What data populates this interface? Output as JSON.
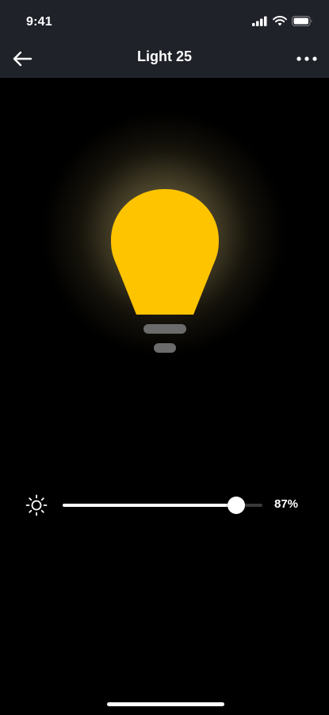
{
  "status_bar": {
    "time": "9:41"
  },
  "header": {
    "title": "Light 25"
  },
  "light": {
    "color": "#FFC400",
    "base_color": "#6b6b6b",
    "glow_color": "#f5dc8c"
  },
  "brightness": {
    "value": 0.87,
    "label": "87%"
  },
  "icons": {
    "back": "back-arrow-icon",
    "more": "more-icon",
    "brightness": "sun-icon"
  }
}
